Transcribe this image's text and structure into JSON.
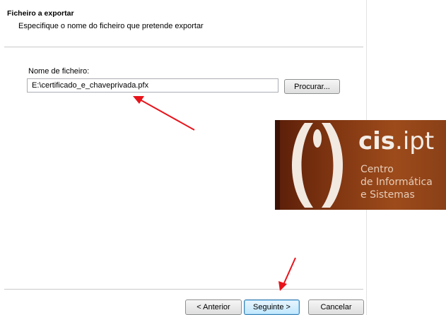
{
  "header": {
    "title": "Ficheiro a exportar",
    "subtitle": "Especifique o nome do ficheiro que pretende exportar"
  },
  "form": {
    "filename_label": "Nome de ficheiro:",
    "filename_value": "E:\\certificado_e_chaveprivada.pfx",
    "browse_label": "Procurar..."
  },
  "footer": {
    "back_label": "< Anterior",
    "next_label": "Seguinte >",
    "cancel_label": "Cancelar"
  },
  "logo": {
    "name_bold": "cis",
    "name_rest": ".ipt",
    "line1": "Centro",
    "line2": "de Informática",
    "line3": "e Sistemas"
  },
  "colors": {
    "annotation_arrow": "#e8141c",
    "logo_background": "#8a4017"
  }
}
